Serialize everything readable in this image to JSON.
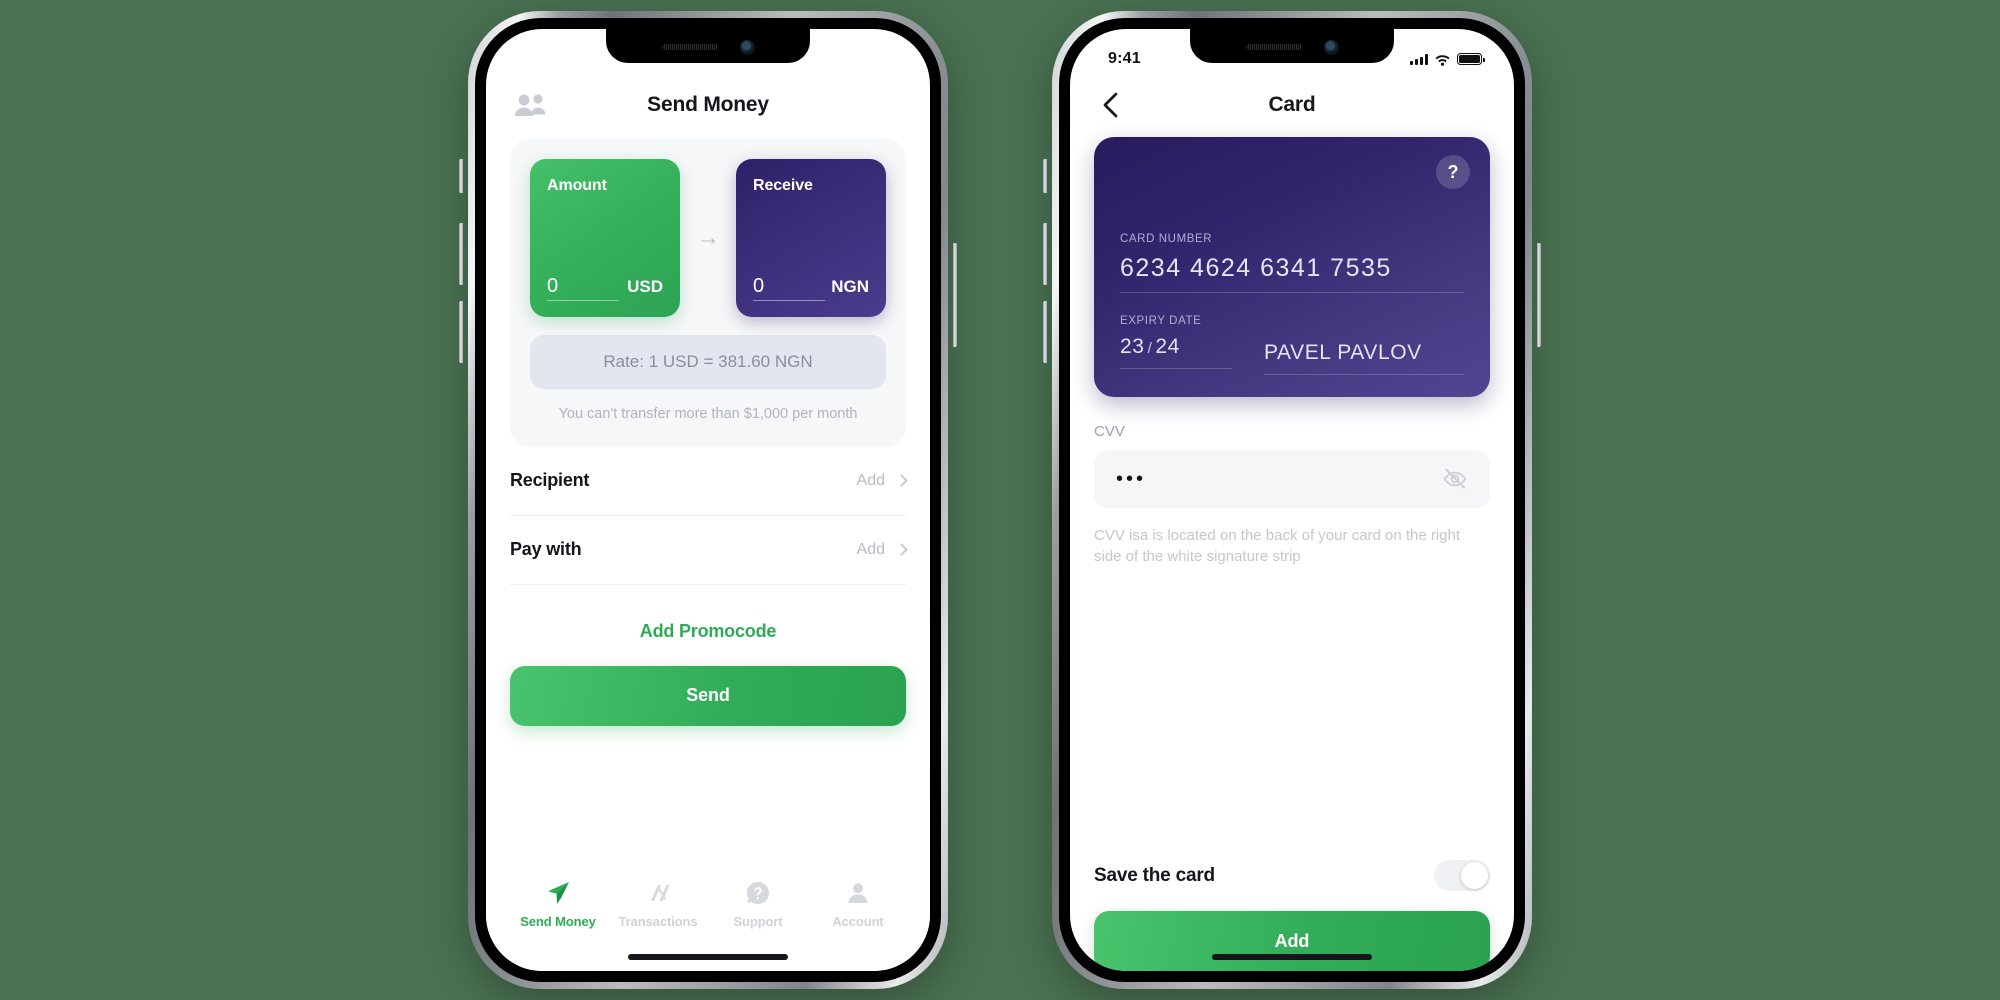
{
  "theme": {
    "background": "#4a7151",
    "green_accent": "#2eab57",
    "purple_accent": "#2d2068",
    "muted_text": "#b6bac2"
  },
  "phone_left": {
    "header": {
      "title": "Send Money",
      "people_icon": "people-icon"
    },
    "exchange": {
      "amount": {
        "label": "Amount",
        "value": "0",
        "currency": "USD"
      },
      "arrow": "→",
      "receive": {
        "label": "Receive",
        "value": "0",
        "currency": "NGN"
      },
      "rate": "Rate: 1 USD = 381.60 NGN",
      "limit_note": "You can't transfer more than $1,000 per month"
    },
    "rows": [
      {
        "label": "Recipient",
        "action": "Add"
      },
      {
        "label": "Pay with",
        "action": "Add"
      }
    ],
    "promocode": "Add Promocode",
    "send_button": "Send",
    "tabs": [
      {
        "label": "Send Money",
        "icon": "send-plane-icon",
        "active": true
      },
      {
        "label": "Transactions",
        "icon": "transactions-icon",
        "active": false
      },
      {
        "label": "Support",
        "icon": "question-bubble-icon",
        "active": false
      },
      {
        "label": "Account",
        "icon": "person-icon",
        "active": false
      }
    ]
  },
  "phone_right": {
    "status_bar": {
      "time": "9:41",
      "cellular": "signal-bars-icon",
      "wifi": "wifi-icon",
      "battery": "battery-full-icon"
    },
    "header": {
      "title": "Card",
      "back_icon": "chevron-left-icon"
    },
    "card": {
      "help_badge": "?",
      "card_number_label": "CARD NUMBER",
      "card_number": "6234  4624  6341  7535",
      "expiry_label": "EXPIRY DATE",
      "expiry_month": "23",
      "expiry_separator": "/",
      "expiry_year": "24",
      "cardholder": "PAVEL PAVLOV"
    },
    "cvv": {
      "label": "CVV",
      "value": "•••",
      "toggle_icon": "eye-off-icon",
      "hint": "CVV isa is located on the back of your card on the right side of the white signature strip"
    },
    "save_card": {
      "label": "Save the card",
      "state": "off"
    },
    "add_button": "Add"
  }
}
